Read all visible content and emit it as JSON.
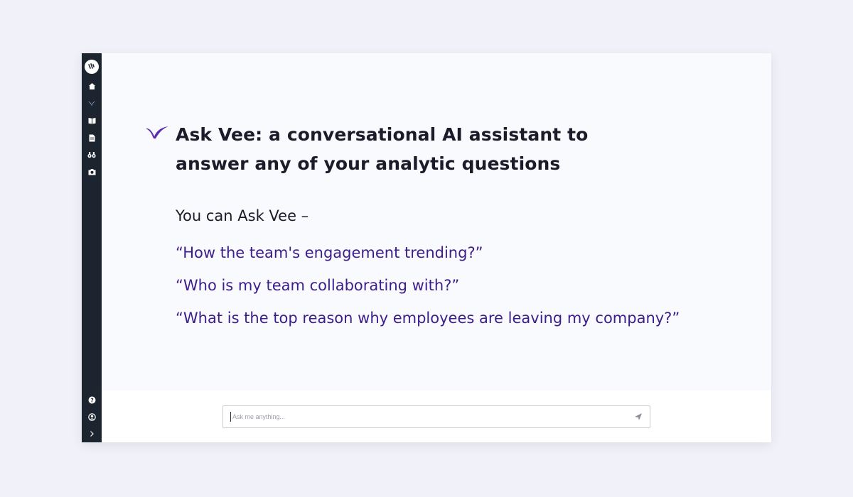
{
  "sidebar": {
    "logo_icon": "app-logo",
    "top_items": [
      "home-icon",
      "ask-vee-icon",
      "book-icon",
      "document-icon",
      "binoculars-icon",
      "camera-icon"
    ],
    "bottom_items": [
      "help-icon",
      "user-icon",
      "expand-chevron-icon"
    ]
  },
  "main": {
    "headline_line1": "Ask Vee: a conversational AI assistant to",
    "headline_line2": "answer any of your analytic questions",
    "intro": "You can Ask Vee –",
    "examples": [
      "“How the team's engagement trending?”",
      "“Who is my team collaborating with?”",
      "“What is the top reason why employees are leaving my company?”"
    ]
  },
  "chat": {
    "placeholder": "Ask me anything...",
    "send_icon": "send-icon"
  },
  "colors": {
    "sidebar": "#1c2430",
    "accent": "#3d1c8c",
    "brand_mark": "#5b2fb0",
    "background": "#f1f2f9"
  }
}
